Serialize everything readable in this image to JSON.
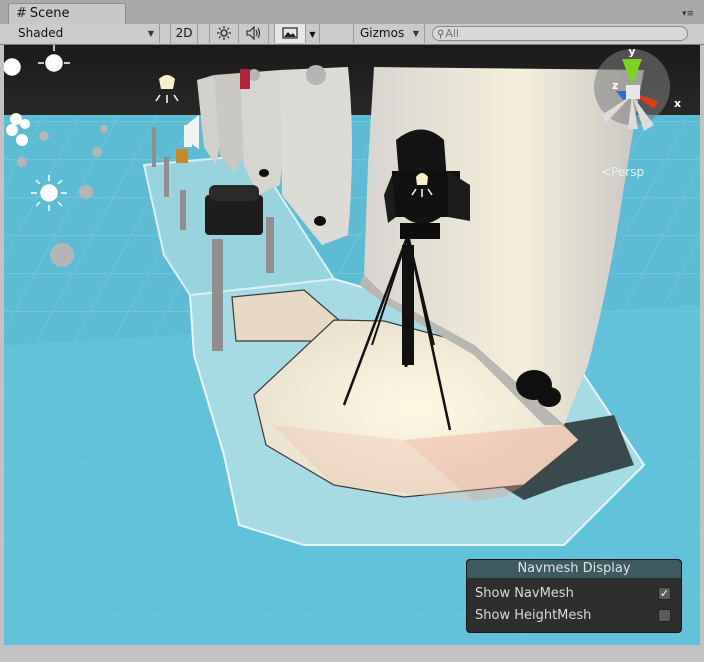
{
  "tab": {
    "icon": "hash-icon",
    "title": "Scene"
  },
  "toolbar": {
    "shading_mode": "Shaded",
    "mode_2d": "2D",
    "gizmos_label": "Gizmos",
    "search_placeholder": "All"
  },
  "gizmo": {
    "x_label": "x",
    "y_label": "y",
    "z_label": "z",
    "projection": "Persp"
  },
  "navmesh_panel": {
    "title": "Navmesh Display",
    "options": [
      {
        "label": "Show NavMesh",
        "checked": true
      },
      {
        "label": "Show HeightMesh",
        "checked": false
      }
    ]
  },
  "colors": {
    "floor": "#64bfd6",
    "navmesh_tint": "#3d5a60",
    "gizmo_x": "#e03a1a",
    "gizmo_y": "#7ed321",
    "gizmo_z": "#2f6be0"
  }
}
